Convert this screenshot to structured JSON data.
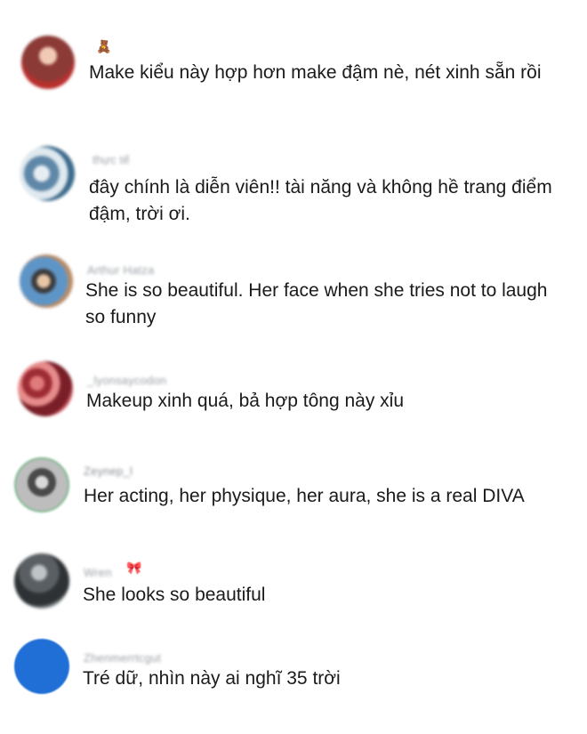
{
  "comments": [
    {
      "username": "",
      "badge_icon": "teddy-bear-emoji",
      "badge_glyph": "🧸",
      "text": "Make kiểu này hợp hơn make đậm nè, nét xinh sẵn rồi"
    },
    {
      "username": "thực tế",
      "text": "đây chính là diễn viên!! tài năng và không hề trang điểm đậm, trời ơi."
    },
    {
      "username": "Arthur Hatza",
      "text": "She is so beautiful. Her face when she tries not to laugh so funny"
    },
    {
      "username": "_lyonsaycodon",
      "text": "Makeup xinh quá, bả hợp tông này xỉu"
    },
    {
      "username": "Zeynep_l",
      "text": "Her acting, her physique, her aura, she is a real DIVA"
    },
    {
      "username": "Wren",
      "badge_icon": "bow-emoji",
      "badge_glyph": "🎀",
      "text": "She looks so beautiful"
    },
    {
      "username": "Zhenmerrtcgut",
      "text": "Tré dữ, nhìn này ai nghĩ 35 trời"
    }
  ],
  "colors": {
    "text": "#1a1a1a",
    "username": "#9aa0a6",
    "avatar_7": "#1f6fd6"
  }
}
